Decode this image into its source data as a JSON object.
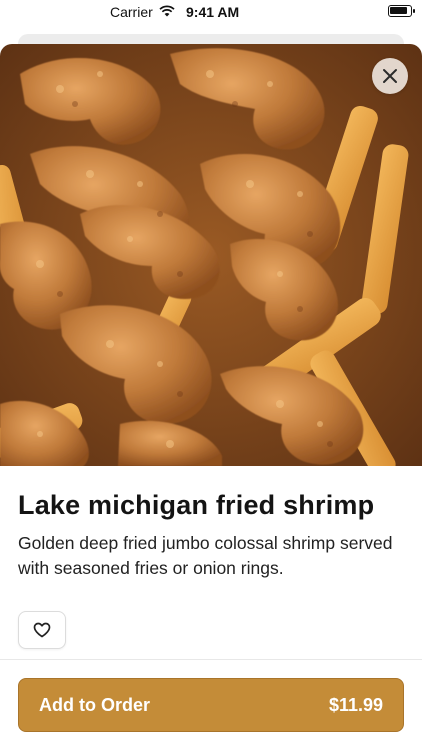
{
  "status_bar": {
    "carrier": "Carrier",
    "time": "9:41 AM"
  },
  "item": {
    "title": "Lake michigan fried shrimp",
    "description": "Golden deep fried jumbo colossal shrimp served with seasoned fries or onion rings."
  },
  "actions": {
    "add_label": "Add to Order",
    "price": "$11.99"
  },
  "icons": {
    "wifi": "wifi-icon",
    "battery": "battery-icon",
    "close": "close-icon",
    "favorite": "heart-icon"
  },
  "colors": {
    "accent": "#c48c38",
    "close_button_bg": "#f0e8e0",
    "text_primary": "#141414"
  }
}
